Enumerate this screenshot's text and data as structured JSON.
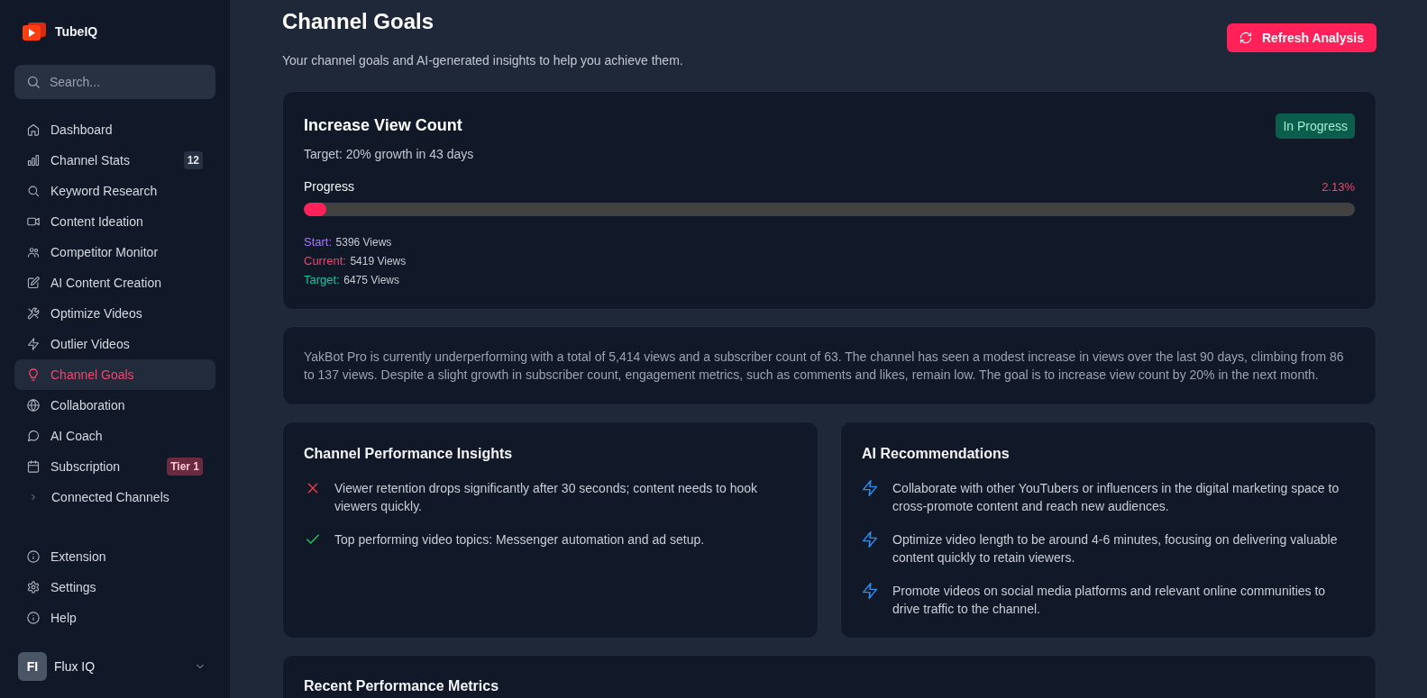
{
  "app": {
    "name": "TubeIQ"
  },
  "sidebar": {
    "search": {
      "placeholder": "Search..."
    },
    "nav": [
      {
        "label": "Dashboard",
        "kind": "link",
        "selected": false
      },
      {
        "label": "Channel Stats",
        "kind": "link",
        "selected": false,
        "badge": {
          "text": "12",
          "kind": "count"
        }
      },
      {
        "label": "Keyword Research",
        "kind": "link",
        "selected": false
      },
      {
        "label": "Content Ideation",
        "kind": "link",
        "selected": false
      },
      {
        "label": "Competitor Monitor",
        "kind": "link",
        "selected": false
      },
      {
        "label": "AI Content Creation",
        "kind": "link",
        "selected": false
      },
      {
        "label": "Optimize Videos",
        "kind": "link",
        "selected": false
      },
      {
        "label": "Outlier Videos",
        "kind": "link",
        "selected": false
      },
      {
        "label": "Channel Goals",
        "kind": "link",
        "selected": true
      },
      {
        "label": "Collaboration",
        "kind": "link",
        "selected": false
      },
      {
        "label": "AI Coach",
        "kind": "link",
        "selected": false
      },
      {
        "label": "Subscription",
        "kind": "link",
        "selected": false,
        "badge": {
          "text": "Tier 1",
          "kind": "tier"
        }
      },
      {
        "label": "Connected Channels",
        "kind": "group",
        "selected": false,
        "expanded": false
      }
    ],
    "footer": [
      {
        "label": "Extension",
        "selected": false
      },
      {
        "label": "Settings",
        "selected": false
      },
      {
        "label": "Help",
        "selected": false
      }
    ],
    "user": {
      "initials": "FI",
      "name": "Flux IQ"
    }
  },
  "header": {
    "title": "Channel Goals",
    "subtitle": "Your channel goals and AI-generated insights to help you achieve them.",
    "action": "Refresh Analysis"
  },
  "goal": {
    "title": "Increase View Count",
    "status": "In Progress",
    "target": "Target: 20% growth in 43 days",
    "progress_label": "Progress",
    "percent": "2.13%",
    "level": 0.0213,
    "stats": [
      {
        "label": "Start:",
        "value": "5396 Views",
        "color": "#a27cf5"
      },
      {
        "label": "Current:",
        "value": "5419 Views",
        "color": "#f0466b"
      },
      {
        "label": "Target:",
        "value": "6475 Views",
        "color": "#1dc4a4"
      }
    ]
  },
  "summary": "YakBot Pro is currently underperforming with a total of 5,414 views and a subscriber count of 63. The channel has seen a modest increase in views over the last 90 days, climbing from 86 to 137 views. Despite a slight growth in subscriber count, engagement metrics, such as comments and likes, remain low. The goal is to increase view count by 20% in the next month.",
  "insights": {
    "title": "Channel Performance Insights",
    "items": [
      {
        "kind": "negative",
        "text": "Viewer retention drops significantly after 30 seconds; content needs to hook viewers quickly."
      },
      {
        "kind": "positive",
        "text": "Top performing video topics: Messenger automation and ad setup."
      }
    ]
  },
  "recommendations": {
    "title": "AI Recommendations",
    "items": [
      "Collaborate with other YouTubers or influencers in the digital marketing space to cross-promote content and reach new audiences.",
      "Optimize video length to be around 4-6 minutes, focusing on delivering valuable content quickly to retain viewers.",
      "Promote videos on social media platforms and relevant online communities to drive traffic to the channel."
    ]
  },
  "metrics": {
    "title": "Recent Performance Metrics"
  }
}
